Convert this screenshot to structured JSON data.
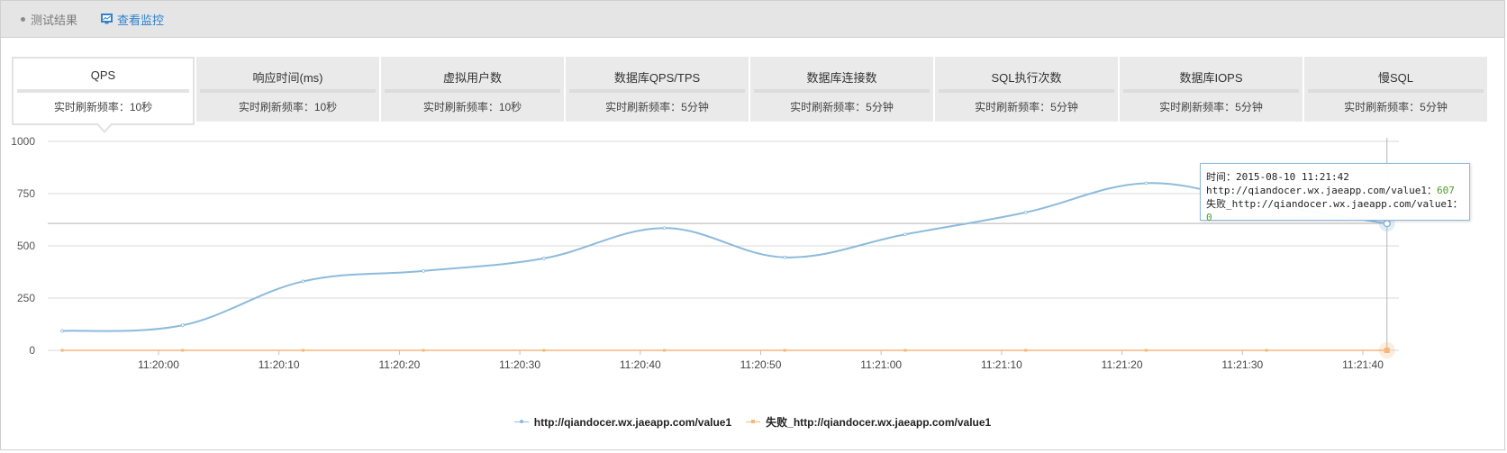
{
  "topbar": {
    "result_label": "测试结果",
    "monitor_label": "查看监控"
  },
  "tabs": [
    {
      "name": "QPS",
      "freq": "实时刷新频率：10秒",
      "active": true
    },
    {
      "name": "响应时间(ms)",
      "freq": "实时刷新频率：10秒",
      "active": false
    },
    {
      "name": "虚拟用户数",
      "freq": "实时刷新频率：10秒",
      "active": false
    },
    {
      "name": "数据库QPS/TPS",
      "freq": "实时刷新频率：5分钟",
      "active": false
    },
    {
      "name": "数据库连接数",
      "freq": "实时刷新频率：5分钟",
      "active": false
    },
    {
      "name": "SQL执行次数",
      "freq": "实时刷新频率：5分钟",
      "active": false
    },
    {
      "name": "数据库IOPS",
      "freq": "实时刷新频率：5分钟",
      "active": false
    },
    {
      "name": "慢SQL",
      "freq": "实时刷新频率：5分钟",
      "active": false
    }
  ],
  "tooltip": {
    "time_line": "时间：2015-08-10 11:21:42",
    "series1_label": "http://qiandocer.wx.jaeapp.com/value1：",
    "series1_value": "607",
    "series2_label": "失败_http://qiandocer.wx.jaeapp.com/value1：",
    "series2_value": "0"
  },
  "colors": {
    "series1": "#8dbbdc",
    "series2": "#f5b77a",
    "grid": "#d8d8d8",
    "accent": "#2f82cf"
  },
  "chart_data": {
    "type": "line",
    "xlabel": "",
    "ylabel": "",
    "ylim": [
      0,
      1000
    ],
    "yticks": [
      0,
      250,
      500,
      750,
      1000
    ],
    "x_tick_labels": [
      "11:20:00",
      "11:20:10",
      "11:20:20",
      "11:20:30",
      "11:20:40",
      "11:20:50",
      "11:21:00",
      "11:21:10",
      "11:21:20",
      "11:21:30",
      "11:21:40"
    ],
    "x_tick_seconds": [
      0,
      10,
      20,
      30,
      40,
      50,
      60,
      70,
      80,
      90,
      100
    ],
    "x_range_seconds": [
      -10,
      102
    ],
    "grid": true,
    "legend_position": "bottom-center",
    "series": [
      {
        "name": "http://qiandocer.wx.jaeapp.com/value1",
        "x_seconds": [
          -8,
          2,
          12,
          22,
          32,
          42,
          52,
          62,
          72,
          82,
          92,
          102
        ],
        "values": [
          93,
          120,
          330,
          380,
          440,
          585,
          445,
          555,
          660,
          800,
          700,
          607
        ]
      },
      {
        "name": "失败_http://qiandocer.wx.jaeapp.com/value1",
        "x_seconds": [
          -8,
          2,
          12,
          22,
          32,
          42,
          52,
          62,
          72,
          82,
          92,
          102
        ],
        "values": [
          0,
          0,
          0,
          0,
          0,
          0,
          0,
          0,
          0,
          0,
          0,
          0
        ]
      }
    ],
    "crosshair_x_seconds": 102
  }
}
